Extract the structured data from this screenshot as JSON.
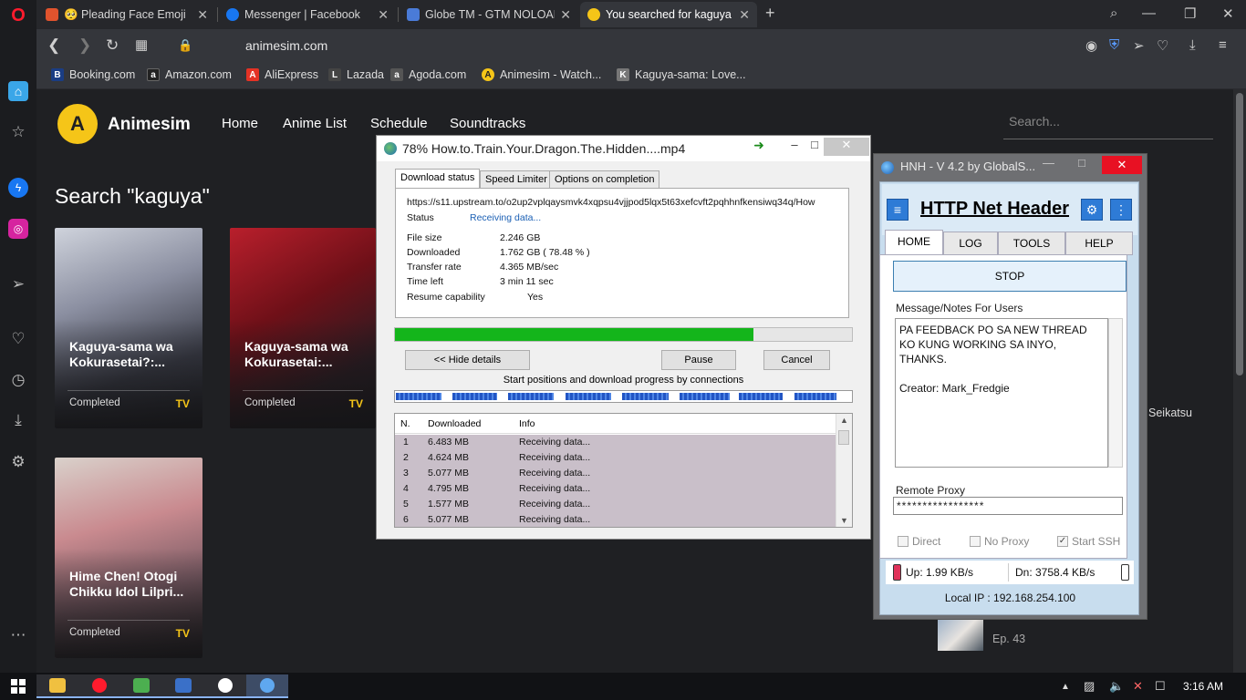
{
  "browser": {
    "tabs": [
      {
        "title": "🥺 Pleading Face Emoji",
        "color": "#e0532d"
      },
      {
        "title": "Messenger | Facebook",
        "color": "#1877f2"
      },
      {
        "title": "Globe TM - GTM NOLOAD",
        "color": "#4a7bd8"
      },
      {
        "title": "You searched for kaguya - /",
        "color": "#f5c518"
      }
    ],
    "url": "animesim.com",
    "bookmarks": [
      {
        "label": "Booking.com",
        "icon": "B",
        "color": "#1a3d84"
      },
      {
        "label": "Amazon.com",
        "icon": "a",
        "color": "#222"
      },
      {
        "label": "AliExpress",
        "icon": "A",
        "color": "#e43225"
      },
      {
        "label": "Lazada",
        "icon": "L",
        "color": "#444"
      },
      {
        "label": "Agoda.com",
        "icon": "a",
        "color": "#555"
      },
      {
        "label": "Animesim - Watch...",
        "icon": "A",
        "color": "#f5c518"
      },
      {
        "label": "Kaguya-sama: Love...",
        "icon": "K",
        "color": "#777"
      }
    ]
  },
  "site": {
    "logo_letter": "A",
    "brand": "Animesim",
    "menu": [
      "Home",
      "Anime List",
      "Schedule",
      "Soundtracks"
    ],
    "search_placeholder": "Search...",
    "search_heading": "Search \"kaguya\"",
    "cards": [
      {
        "title": "Kaguya-sama wa Kokurasetai?:...",
        "status": "Completed",
        "type": "TV"
      },
      {
        "title": "Kaguya-sama wa Kokurasetai:...",
        "status": "Completed",
        "type": "TV"
      },
      {
        "title": "Hime Chen! Otogi Chikku Idol Lilpri...",
        "status": "Completed",
        "type": "TV"
      }
    ],
    "side_text": "Seikatsu",
    "episode": "Ep. 43"
  },
  "idm": {
    "title": "78% How.to.Train.Your.Dragon.The.Hidden....mp4",
    "tabs": [
      "Download status",
      "Speed Limiter",
      "Options on completion"
    ],
    "url": "https://s11.upstream.to/o2up2vplqaysmvk4xqpsu4vjjpod5lqx5t63xefcvft2pqhhnfkensiwq34q/How",
    "status_label": "Status",
    "status_value": "Receiving data...",
    "file_size_label": "File size",
    "file_size": "2.246  GB",
    "downloaded_label": "Downloaded",
    "downloaded": "1.762  GB  ( 78.48 % )",
    "transfer_rate_label": "Transfer rate",
    "transfer_rate": "4.365  MB/sec",
    "time_left_label": "Time left",
    "time_left": "3 min 11 sec",
    "resume_label": "Resume capability",
    "resume": "Yes",
    "progress": 0.7848,
    "hide_details": "<< Hide details",
    "pause": "Pause",
    "cancel": "Cancel",
    "connections_label": "Start positions and download progress by connections",
    "columns": [
      "N.",
      "Downloaded",
      "Info"
    ],
    "connections": [
      {
        "n": "1",
        "downloaded": "6.483  MB",
        "info": "Receiving data..."
      },
      {
        "n": "2",
        "downloaded": "4.624  MB",
        "info": "Receiving data..."
      },
      {
        "n": "3",
        "downloaded": "5.077  MB",
        "info": "Receiving data..."
      },
      {
        "n": "4",
        "downloaded": "4.795  MB",
        "info": "Receiving data..."
      },
      {
        "n": "5",
        "downloaded": "1.577  MB",
        "info": "Receiving data..."
      },
      {
        "n": "6",
        "downloaded": "5.077  MB",
        "info": "Receiving data..."
      }
    ]
  },
  "hnh": {
    "title": "HNH - V 4.2 by GlobalS...",
    "header": "HTTP Net Header",
    "tabs": [
      "HOME",
      "LOG",
      "TOOLS",
      "HELP"
    ],
    "stop": "STOP",
    "notes_label": "Message/Notes For Users",
    "notes": "PA FEEDBACK PO SA NEW THREAD KO KUNG WORKING SA INYO, THANKS.\n\nCreator: Mark_Fredgie",
    "proxy_label": "Remote Proxy",
    "proxy_value": "*****************",
    "direct": "Direct",
    "no_proxy": "No Proxy",
    "start_ssh": "Start SSH",
    "up": "Up: 1.99 KB/s",
    "dn": "Dn: 3758.4 KB/s",
    "local_ip": "Local IP : 192.168.254.100"
  },
  "taskbar": {
    "time": "3:16 AM"
  }
}
